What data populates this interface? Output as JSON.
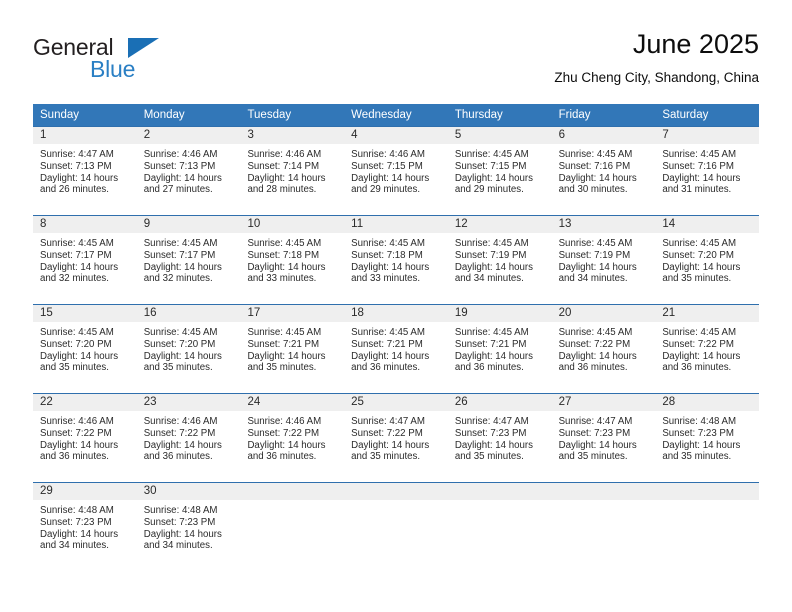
{
  "brand": {
    "name_part1": "General",
    "name_part2": "Blue"
  },
  "header": {
    "title": "June 2025",
    "subtitle": "Zhu Cheng City, Shandong, China"
  },
  "colors": {
    "header_blue": "#3277b8",
    "row_divider_blue": "#2f6fad",
    "daynum_band": "#efefef",
    "brand_blue": "#2a7fc4"
  },
  "weekdays": [
    "Sunday",
    "Monday",
    "Tuesday",
    "Wednesday",
    "Thursday",
    "Friday",
    "Saturday"
  ],
  "weeks": [
    [
      {
        "day": "1",
        "sunrise": "Sunrise: 4:47 AM",
        "sunset": "Sunset: 7:13 PM",
        "daylight1": "Daylight: 14 hours",
        "daylight2": "and 26 minutes."
      },
      {
        "day": "2",
        "sunrise": "Sunrise: 4:46 AM",
        "sunset": "Sunset: 7:13 PM",
        "daylight1": "Daylight: 14 hours",
        "daylight2": "and 27 minutes."
      },
      {
        "day": "3",
        "sunrise": "Sunrise: 4:46 AM",
        "sunset": "Sunset: 7:14 PM",
        "daylight1": "Daylight: 14 hours",
        "daylight2": "and 28 minutes."
      },
      {
        "day": "4",
        "sunrise": "Sunrise: 4:46 AM",
        "sunset": "Sunset: 7:15 PM",
        "daylight1": "Daylight: 14 hours",
        "daylight2": "and 29 minutes."
      },
      {
        "day": "5",
        "sunrise": "Sunrise: 4:45 AM",
        "sunset": "Sunset: 7:15 PM",
        "daylight1": "Daylight: 14 hours",
        "daylight2": "and 29 minutes."
      },
      {
        "day": "6",
        "sunrise": "Sunrise: 4:45 AM",
        "sunset": "Sunset: 7:16 PM",
        "daylight1": "Daylight: 14 hours",
        "daylight2": "and 30 minutes."
      },
      {
        "day": "7",
        "sunrise": "Sunrise: 4:45 AM",
        "sunset": "Sunset: 7:16 PM",
        "daylight1": "Daylight: 14 hours",
        "daylight2": "and 31 minutes."
      }
    ],
    [
      {
        "day": "8",
        "sunrise": "Sunrise: 4:45 AM",
        "sunset": "Sunset: 7:17 PM",
        "daylight1": "Daylight: 14 hours",
        "daylight2": "and 32 minutes."
      },
      {
        "day": "9",
        "sunrise": "Sunrise: 4:45 AM",
        "sunset": "Sunset: 7:17 PM",
        "daylight1": "Daylight: 14 hours",
        "daylight2": "and 32 minutes."
      },
      {
        "day": "10",
        "sunrise": "Sunrise: 4:45 AM",
        "sunset": "Sunset: 7:18 PM",
        "daylight1": "Daylight: 14 hours",
        "daylight2": "and 33 minutes."
      },
      {
        "day": "11",
        "sunrise": "Sunrise: 4:45 AM",
        "sunset": "Sunset: 7:18 PM",
        "daylight1": "Daylight: 14 hours",
        "daylight2": "and 33 minutes."
      },
      {
        "day": "12",
        "sunrise": "Sunrise: 4:45 AM",
        "sunset": "Sunset: 7:19 PM",
        "daylight1": "Daylight: 14 hours",
        "daylight2": "and 34 minutes."
      },
      {
        "day": "13",
        "sunrise": "Sunrise: 4:45 AM",
        "sunset": "Sunset: 7:19 PM",
        "daylight1": "Daylight: 14 hours",
        "daylight2": "and 34 minutes."
      },
      {
        "day": "14",
        "sunrise": "Sunrise: 4:45 AM",
        "sunset": "Sunset: 7:20 PM",
        "daylight1": "Daylight: 14 hours",
        "daylight2": "and 35 minutes."
      }
    ],
    [
      {
        "day": "15",
        "sunrise": "Sunrise: 4:45 AM",
        "sunset": "Sunset: 7:20 PM",
        "daylight1": "Daylight: 14 hours",
        "daylight2": "and 35 minutes."
      },
      {
        "day": "16",
        "sunrise": "Sunrise: 4:45 AM",
        "sunset": "Sunset: 7:20 PM",
        "daylight1": "Daylight: 14 hours",
        "daylight2": "and 35 minutes."
      },
      {
        "day": "17",
        "sunrise": "Sunrise: 4:45 AM",
        "sunset": "Sunset: 7:21 PM",
        "daylight1": "Daylight: 14 hours",
        "daylight2": "and 35 minutes."
      },
      {
        "day": "18",
        "sunrise": "Sunrise: 4:45 AM",
        "sunset": "Sunset: 7:21 PM",
        "daylight1": "Daylight: 14 hours",
        "daylight2": "and 36 minutes."
      },
      {
        "day": "19",
        "sunrise": "Sunrise: 4:45 AM",
        "sunset": "Sunset: 7:21 PM",
        "daylight1": "Daylight: 14 hours",
        "daylight2": "and 36 minutes."
      },
      {
        "day": "20",
        "sunrise": "Sunrise: 4:45 AM",
        "sunset": "Sunset: 7:22 PM",
        "daylight1": "Daylight: 14 hours",
        "daylight2": "and 36 minutes."
      },
      {
        "day": "21",
        "sunrise": "Sunrise: 4:45 AM",
        "sunset": "Sunset: 7:22 PM",
        "daylight1": "Daylight: 14 hours",
        "daylight2": "and 36 minutes."
      }
    ],
    [
      {
        "day": "22",
        "sunrise": "Sunrise: 4:46 AM",
        "sunset": "Sunset: 7:22 PM",
        "daylight1": "Daylight: 14 hours",
        "daylight2": "and 36 minutes."
      },
      {
        "day": "23",
        "sunrise": "Sunrise: 4:46 AM",
        "sunset": "Sunset: 7:22 PM",
        "daylight1": "Daylight: 14 hours",
        "daylight2": "and 36 minutes."
      },
      {
        "day": "24",
        "sunrise": "Sunrise: 4:46 AM",
        "sunset": "Sunset: 7:22 PM",
        "daylight1": "Daylight: 14 hours",
        "daylight2": "and 36 minutes."
      },
      {
        "day": "25",
        "sunrise": "Sunrise: 4:47 AM",
        "sunset": "Sunset: 7:22 PM",
        "daylight1": "Daylight: 14 hours",
        "daylight2": "and 35 minutes."
      },
      {
        "day": "26",
        "sunrise": "Sunrise: 4:47 AM",
        "sunset": "Sunset: 7:23 PM",
        "daylight1": "Daylight: 14 hours",
        "daylight2": "and 35 minutes."
      },
      {
        "day": "27",
        "sunrise": "Sunrise: 4:47 AM",
        "sunset": "Sunset: 7:23 PM",
        "daylight1": "Daylight: 14 hours",
        "daylight2": "and 35 minutes."
      },
      {
        "day": "28",
        "sunrise": "Sunrise: 4:48 AM",
        "sunset": "Sunset: 7:23 PM",
        "daylight1": "Daylight: 14 hours",
        "daylight2": "and 35 minutes."
      }
    ],
    [
      {
        "day": "29",
        "sunrise": "Sunrise: 4:48 AM",
        "sunset": "Sunset: 7:23 PM",
        "daylight1": "Daylight: 14 hours",
        "daylight2": "and 34 minutes."
      },
      {
        "day": "30",
        "sunrise": "Sunrise: 4:48 AM",
        "sunset": "Sunset: 7:23 PM",
        "daylight1": "Daylight: 14 hours",
        "daylight2": "and 34 minutes."
      },
      {
        "day": "",
        "sunrise": "",
        "sunset": "",
        "daylight1": "",
        "daylight2": ""
      },
      {
        "day": "",
        "sunrise": "",
        "sunset": "",
        "daylight1": "",
        "daylight2": ""
      },
      {
        "day": "",
        "sunrise": "",
        "sunset": "",
        "daylight1": "",
        "daylight2": ""
      },
      {
        "day": "",
        "sunrise": "",
        "sunset": "",
        "daylight1": "",
        "daylight2": ""
      },
      {
        "day": "",
        "sunrise": "",
        "sunset": "",
        "daylight1": "",
        "daylight2": ""
      }
    ]
  ]
}
